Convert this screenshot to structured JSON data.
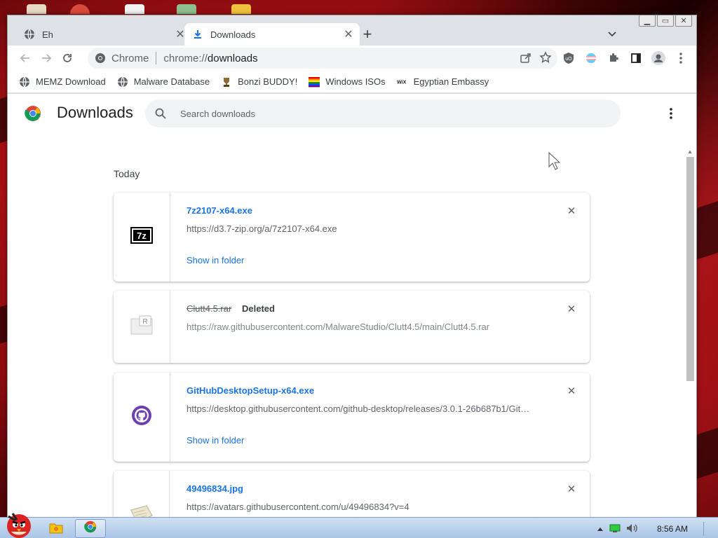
{
  "browser": {
    "tabs": [
      {
        "title": "Eh",
        "active": false
      },
      {
        "title": "Downloads",
        "active": true
      }
    ],
    "omnibox": {
      "site_label": "Chrome",
      "url_scheme": "chrome://",
      "url_host": "downloads"
    },
    "bookmarks": [
      {
        "label": "MEMZ Download",
        "icon": "globe-icon"
      },
      {
        "label": "Malware Database",
        "icon": "globe-icon"
      },
      {
        "label": "Bonzi BUDDY!",
        "icon": "trophy-icon"
      },
      {
        "label": "Windows ISOs",
        "icon": "rainbow-flag-icon"
      },
      {
        "label": "Egyptian Embassy",
        "icon": "wix-icon"
      }
    ]
  },
  "downloads_page": {
    "title": "Downloads",
    "search_placeholder": "Search downloads",
    "section_label": "Today",
    "items": [
      {
        "filename": "7z2107-x64.exe",
        "url": "https://d3.7-zip.org/a/7z2107-x64.exe",
        "action": "Show in folder",
        "status": "",
        "icon": "7zip-icon",
        "deleted": false
      },
      {
        "filename": "Clutt4.5.rar",
        "url": "https://raw.githubusercontent.com/MalwareStudio/Clutt4.5/main/Clutt4.5.rar",
        "action": "",
        "status": "Deleted",
        "icon": "winrar-archive-icon",
        "deleted": true
      },
      {
        "filename": "GitHubDesktopSetup-x64.exe",
        "url": "https://desktop.githubusercontent.com/github-desktop/releases/3.0.1-26b687b1/Git…",
        "action": "Show in folder",
        "status": "",
        "icon": "github-icon",
        "deleted": false
      },
      {
        "filename": "49496834.jpg",
        "url": "https://avatars.githubusercontent.com/u/49496834?v=4",
        "action": "",
        "status": "",
        "icon": "image-file-icon",
        "deleted": false
      }
    ]
  },
  "taskbar": {
    "clock": "8:56 AM"
  },
  "colors": {
    "link": "#1a73e8",
    "accent_download": "#1a73e8",
    "github_purple": "#6e3fb0"
  }
}
